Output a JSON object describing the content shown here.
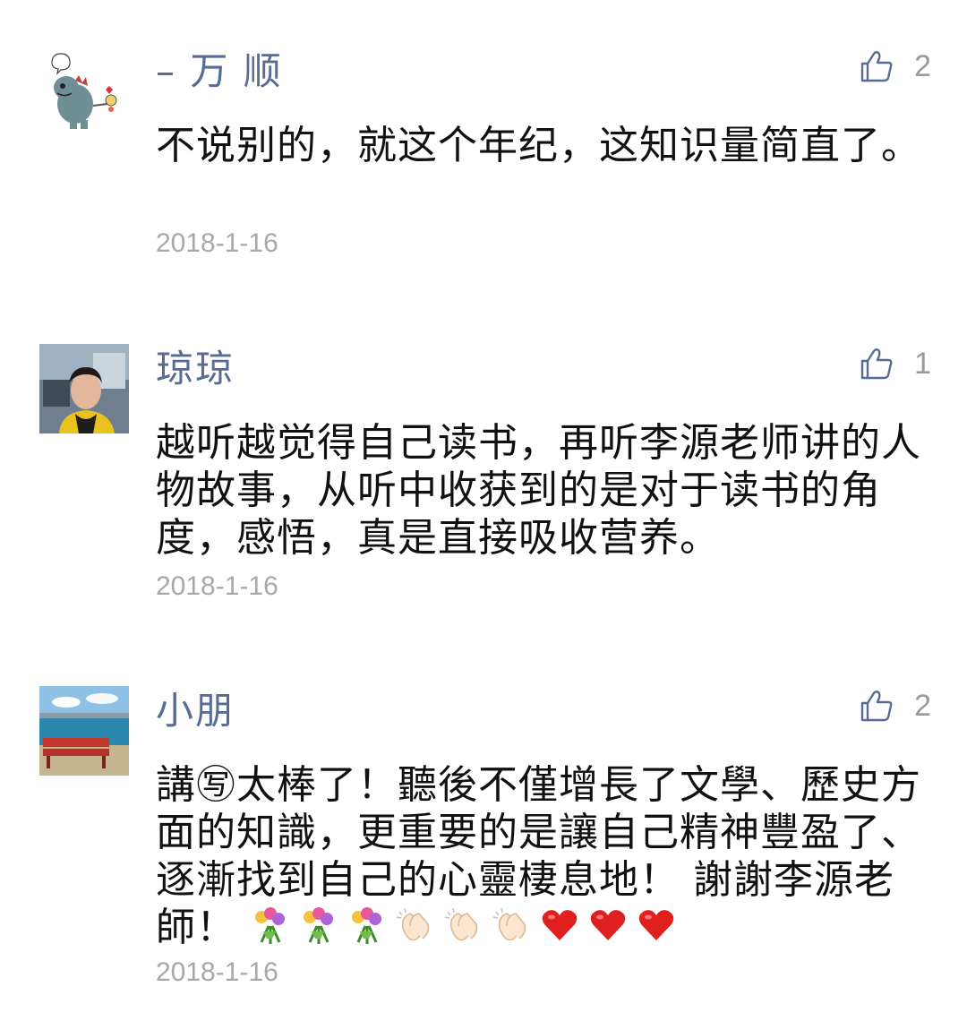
{
  "comments": [
    {
      "username": "– 万 顺",
      "likes": "2",
      "text": "不说别的，就这个年纪，这知识量简直了。",
      "date": "2018-1-16",
      "avatar": "cartoon-dinosaur-avatar"
    },
    {
      "username": "琼琼",
      "likes": "1",
      "text": "越听越觉得自己读书，再听李源老师讲的人物故事，从听中收获到的是对于读书的角度，感悟，真是直接吸收营养。",
      "date": "2018-1-16",
      "avatar": "woman-portrait-avatar"
    },
    {
      "username": "小朋",
      "likes": "2",
      "text": "講㊢太棒了！聽後不僅增長了文學、歷史方面的知識，更重要的是讓自己精神豐盈了、逐漸找到自己的心靈棲息地！ 謝謝李源老師！",
      "date": "2018-1-16",
      "avatar": "seaside-bench-avatar",
      "emojis": [
        "bouquet-icon",
        "bouquet-icon",
        "bouquet-icon",
        "clapping-hands-icon",
        "clapping-hands-icon",
        "clapping-hands-icon",
        "heart-icon",
        "heart-icon",
        "heart-icon"
      ]
    }
  ],
  "colors": {
    "username": "#576b95",
    "text": "#111111",
    "meta": "#a8a8a8",
    "heart": "#e0201f"
  }
}
